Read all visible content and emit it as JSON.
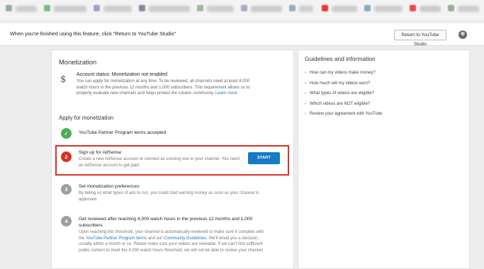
{
  "banner": {
    "instruction": "When you're finished using this feature, click \"Return to YouTube Studio\"",
    "return_label": "Return to YouTube Studio"
  },
  "monetization": {
    "title": "Monetization",
    "status_title": "Account status: Monetization not enabled",
    "status_body": "You can apply for monetization at any time. To be reviewed, all channels need at least 4,000 watch hours in the previous 12 months and 1,000 subscribers. This requirement allows us to properly evaluate new channels and helps protect the creator community.",
    "learn_more": "Learn more",
    "apply_title": "Apply for monetization",
    "steps": [
      {
        "icon": "✓",
        "title": "YouTube Partner Program terms accepted",
        "state": "done"
      },
      {
        "icon": "2",
        "title": "Sign up for AdSense",
        "desc": "Create a new AdSense account or connect an existing one to your channel. You need an AdSense account to get paid.",
        "button": "START",
        "state": "active"
      },
      {
        "icon": "3",
        "title": "Set monetization preferences",
        "desc": "By telling us what types of ads to run, you could start earning money as soon as your channel is approved.",
        "state": "pending"
      },
      {
        "icon": "4",
        "title": "Get reviewed after reaching 4,000 watch hours in the previous 12 months and 1,000 subscribers",
        "desc_a": "Upon reaching this threshold, your channel is automatically reviewed to make sure it complies with the",
        "desc_link1": "YouTube Partner Program terms",
        "desc_b": "and our",
        "desc_link2": "Community Guidelines",
        "desc_c": ". We'll email you a decision, usually within a month or so. Please make sure your videos are viewable. If we can't find sufficient public content to meet the 4,000 watch hours threshold, we will not be able to review your channel.",
        "state": "pending"
      }
    ]
  },
  "guidelines": {
    "title": "Guidelines and information",
    "items": [
      "How can my videos make money?",
      "How much will my videos earn?",
      "What types of videos are eligible?",
      "Which videos are NOT eligible?",
      "Review your agreement with YouTube"
    ]
  },
  "colors": {
    "accent": "#167ac6",
    "done": "#4caf50",
    "active": "#d93025",
    "pending": "#9e9e9e",
    "highlight": "#d93025"
  }
}
